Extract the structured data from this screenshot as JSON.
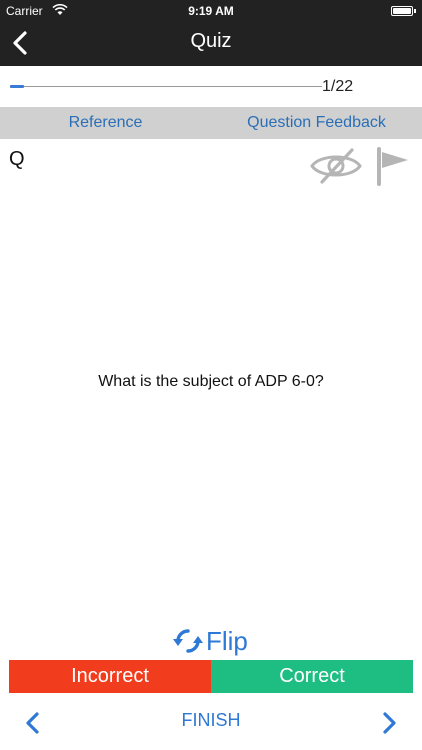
{
  "status_bar": {
    "carrier": "Carrier",
    "time": "9:19 AM",
    "wifi_icon": "wifi-icon",
    "battery_icon": "battery-icon"
  },
  "nav": {
    "title": "Quiz",
    "back_icon": "chevron-left-icon"
  },
  "progress": {
    "current": 1,
    "total": 22,
    "label": "1/22"
  },
  "reference_bar": {
    "reference_label": "Reference",
    "feedback_label": "Question Feedback"
  },
  "card": {
    "side_label": "Q",
    "hide_icon": "eye-slash-icon",
    "flag_icon": "flag-icon",
    "question": "What is the subject of ADP 6-0?"
  },
  "flip": {
    "label": "Flip",
    "icon": "flip-arrows-icon"
  },
  "answer": {
    "incorrect_label": "Incorrect",
    "correct_label": "Correct"
  },
  "bottom_nav": {
    "finish_label": "FINISH",
    "prev_icon": "chevron-left-icon",
    "next_icon": "chevron-right-icon"
  },
  "colors": {
    "header_bg": "#222222",
    "link_blue": "#2a6fb6",
    "accent_blue": "#2e78d6",
    "incorrect_red": "#f23c1e",
    "correct_green": "#1ebe83",
    "ref_bar_bg": "#d0d0d0",
    "icon_gray": "#b5b5b5"
  }
}
